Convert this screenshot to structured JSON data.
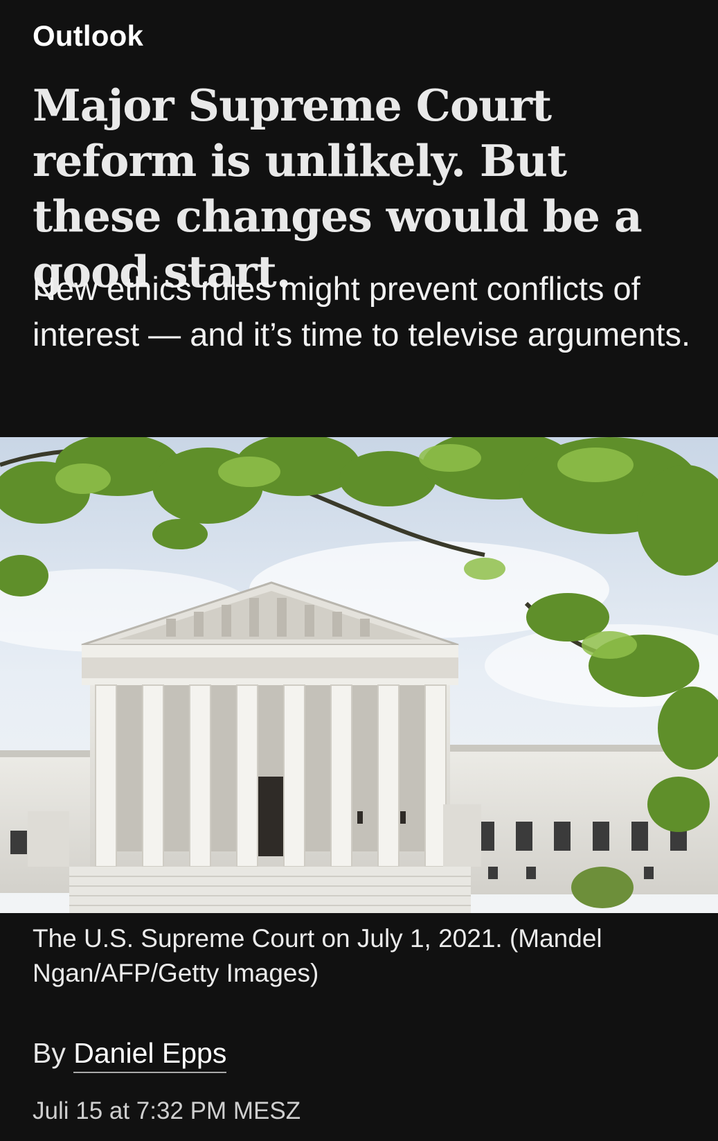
{
  "article": {
    "section": "Outlook",
    "headline": "Major Supreme Court reform is unlikely. But these changes would be a good start.",
    "dek": "New ethics rules might prevent conflicts of interest — and it’s time to televise arguments.",
    "image": {
      "caption": "The U.S. Supreme Court on July 1, 2021. (Mandel Ngan/AFP/Getty Images)"
    },
    "byline": {
      "prefix": "By",
      "author": "Daniel Epps"
    },
    "timestamp": "Juli 15 at 7:32 PM MESZ"
  },
  "colors": {
    "background": "#111111",
    "text": "#f2f2f2"
  }
}
